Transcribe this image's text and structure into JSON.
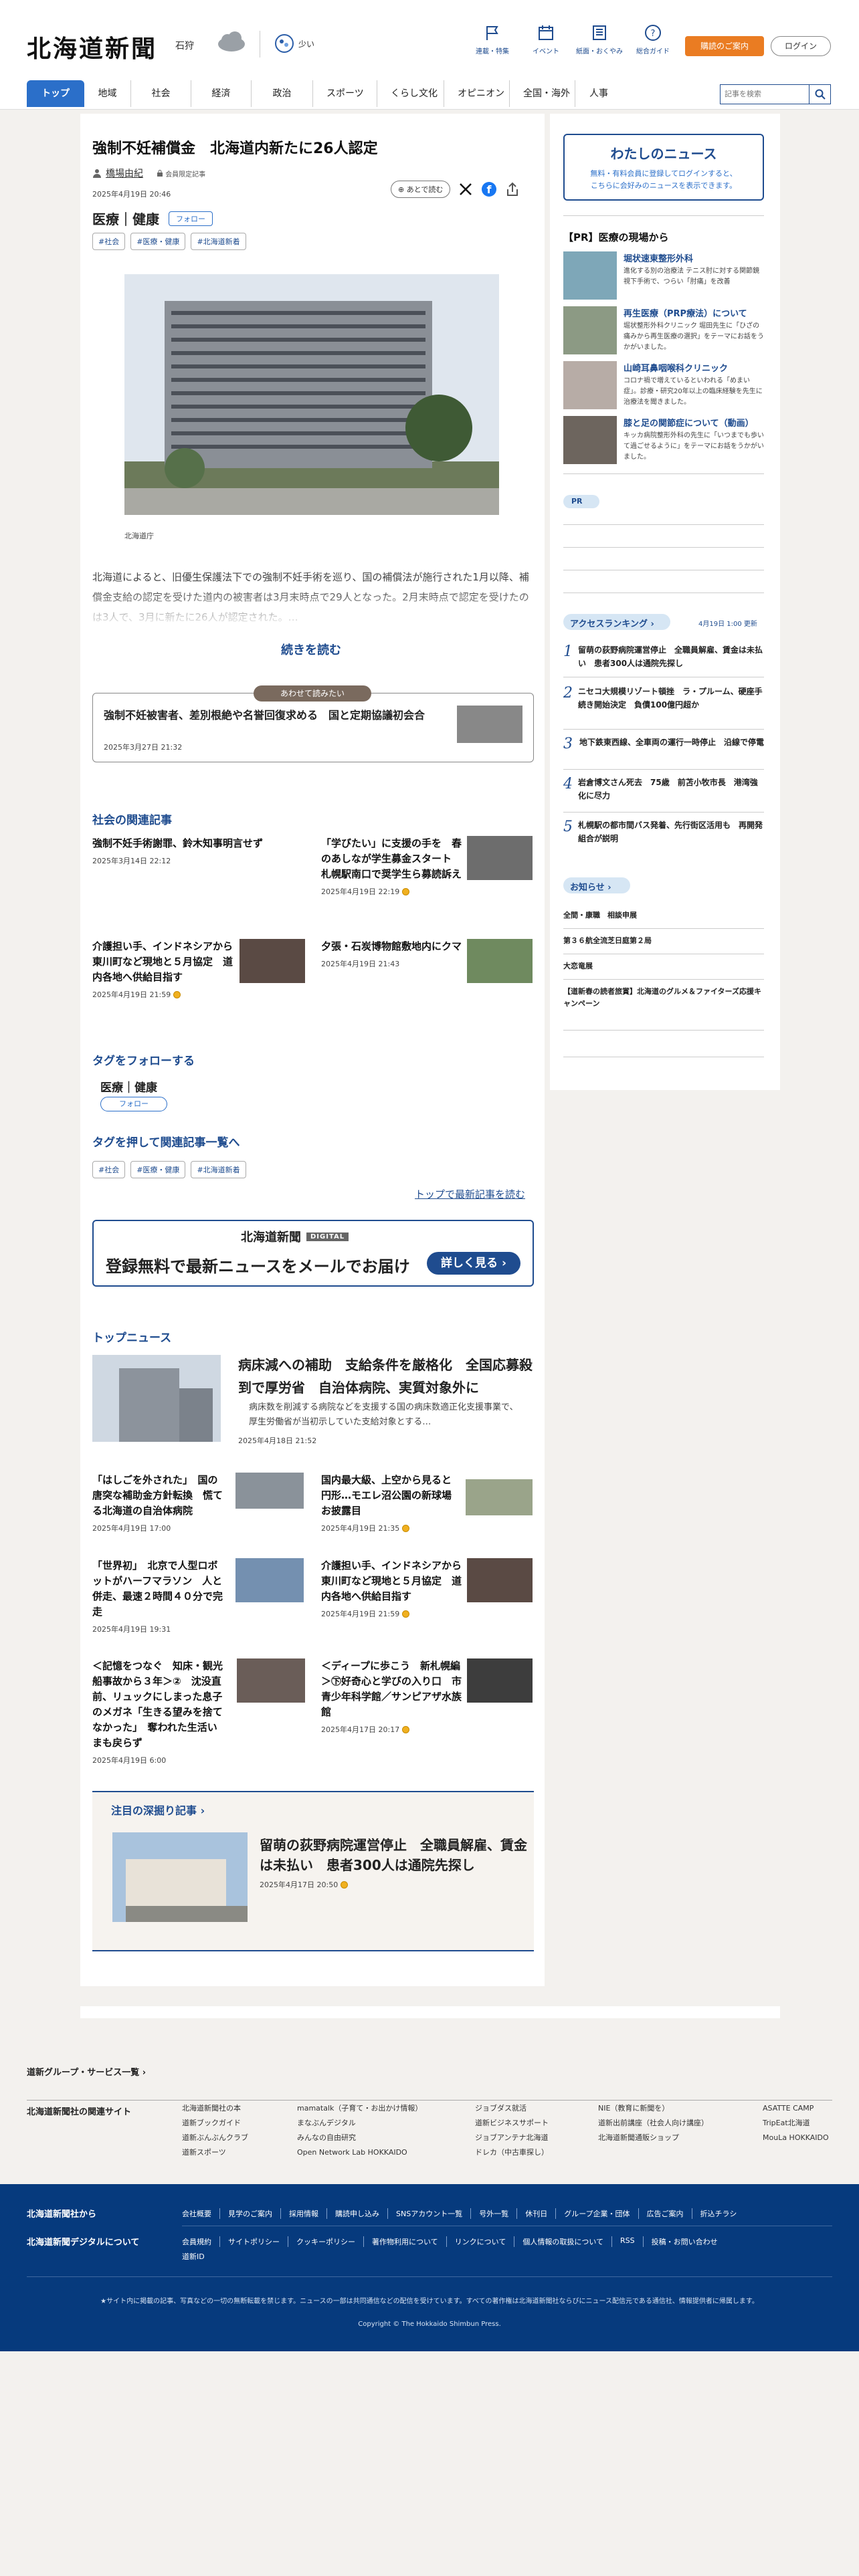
{
  "header": {
    "logo": "北海道新聞",
    "location": "石狩",
    "pollen": "少い",
    "icons": [
      {
        "label": "連載・特集",
        "icon": "flag-icon"
      },
      {
        "label": "イベント",
        "icon": "calendar-icon"
      },
      {
        "label": "紙面・おくやみ",
        "icon": "newspaper-icon"
      },
      {
        "label": "総合ガイド",
        "icon": "question-icon"
      }
    ],
    "subscribe": "購読のご案内",
    "login": "ログイン"
  },
  "nav": {
    "items": [
      "トップ",
      "地域",
      "社会",
      "経済",
      "政治",
      "スポーツ",
      "くらし文化",
      "オピニオン",
      "全国・海外",
      "人事"
    ],
    "search_placeholder": "記事を検索"
  },
  "article": {
    "title": "強制不妊補償金　北海道内新たに26人認定",
    "author": "橋場由紀",
    "member_tag": "会員限定記事",
    "date": "2025年4月19日 20:46",
    "later": "あとで読む",
    "categories": "医療｜健康",
    "follow": "フォロー",
    "tags": [
      "#社会",
      "#医療・健康",
      "#北海道新着"
    ],
    "caption": "北海道庁",
    "lead": "北海道によると、旧優生保護法下での強制不妊手術を巡り、国の補償法が施行された1月以降、補償金支給の認定を受けた道内の被害者は3月末時点で29人となった。2月末時点で認定を受けたのは3人で、3月に新たに26人が認定された。…",
    "read_more": "続きを読む"
  },
  "also_read": {
    "badge": "あわせて読みたい",
    "title": "強制不妊被害者、差別根絶や名誉回復求める　国と定期協議初会合",
    "date": "2025年3月27日 21:32"
  },
  "related": {
    "heading": "社会の関連記事",
    "items": [
      {
        "title": "強制不妊手術謝罪、鈴木知事明言せず",
        "date": "2025年3月14日 22:12"
      },
      {
        "title": "「学びたい」に支援の手を　春のあしなが学生募金スタート　札幌駅南口で奨学生ら募読訴え",
        "date": "2025年4月19日 22:19"
      },
      {
        "title": "介護担い手、インドネシアから　東川町など現地と５月協定　道内各地へ供給目指す",
        "date": "2025年4月19日 21:59"
      },
      {
        "title": "夕張・石炭博物館敷地内にクマ",
        "date": "2025年4月19日 21:43"
      }
    ]
  },
  "follow_tags": {
    "heading": "タグをフォローする",
    "name": "医療｜健康",
    "button": "フォロー"
  },
  "tag_links": {
    "heading": "タグを押して関連記事一覧へ",
    "tags": [
      "#社会",
      "#医療・健康",
      "#北海道新着"
    ],
    "more": "トップで最新記事を読む"
  },
  "banner": {
    "logo": "北海道新聞",
    "digital": "DIGITAL",
    "text": "登録無料で最新ニュースをメールでお届け",
    "button": "詳しく見る"
  },
  "top_news": {
    "heading": "トップニュース",
    "main": {
      "title": "病床減への補助　支給条件を厳格化　全国応募殺到で厚労省　自治体病院、実質対象外に",
      "summary": "病床数を削減する病院などを支援する国の病床数適正化支援事業で、厚生労働省が当初示していた支給対象とする…",
      "date": "2025年4月18日 21:52"
    },
    "items": [
      {
        "title": "「はしごを外された」　国の唐突な補助金方針転換　慌てる北海道の自治体病院",
        "date": "2025年4月19日 17:00"
      },
      {
        "title": "国内最大級、上空から見ると円形…モエレ沼公園の新球場お披露目",
        "date": "2025年4月19日 21:35"
      },
      {
        "title": "「世界初」　北京で人型ロボットがハーフマラソン　人と併走、最速２時間４０分で完走",
        "date": "2025年4月19日 19:31"
      },
      {
        "title": "介護担い手、インドネシアから　東川町など現地と５月協定　道内各地へ供給目指す",
        "date": "2025年4月19日 21:59"
      },
      {
        "title": "＜記憶をつなぐ　知床・観光船事故から３年＞②　沈没直前、リュックにしまった息子のメガネ「生きる望みを捨てなかった」　奪われた生活いまも戻らず",
        "date": "2025年4月19日 6:00"
      },
      {
        "title": "＜ディープに歩こう　新札幌編＞㊦好奇心と学びの入り口　市青少年科学館／サンピアザ水族館",
        "date": "2025年4月17日 20:17"
      }
    ]
  },
  "deep_dive": {
    "heading": "注目の深掘り記事",
    "title": "留萌の荻野病院運営停止　全職員解雇、賃金は未払い　患者300人は通院先探し",
    "date": "2025年4月17日 20:50"
  },
  "sidebar": {
    "mynews_title": "わたしのニュース",
    "mynews_text1": "無料・有料会員に登録してログインすると、",
    "mynews_text2": "こちらに会好みのニュースを表示できます。",
    "pr_heading": "【PR】医療の現場から",
    "pr_items": [
      {
        "title": "堀状速東整形外科",
        "text": "進化する別の治療法 テニス肘に対する関節鏡視下手術で、つらい「肘痛」を改善"
      },
      {
        "title": "再生医療（PRP療法）について",
        "text": "堀状整形外科クリニック 堀田先生に「ひざの痛みから再生医療の選択」をテーマにお話をうかがいました。"
      },
      {
        "title": "山崎耳鼻咽喉科クリニック",
        "text": "コロナ禍で増えているといわれる「めまい症」。診療・研究20年以上の臨床経験を先生に治療法を聞きました。"
      },
      {
        "title": "膝と足の関節症について（動画）",
        "text": "キッカ病院整形外科の先生に「いつまでも歩いて過ごせるように」をテーマにお話をうかがいました。"
      }
    ],
    "pr_label": "PR",
    "ranking_heading": "アクセスランキング",
    "ranking_time": "4月19日 1:00 更新",
    "ranking": [
      {
        "rank": "1",
        "title": "留萌の荻野病院運営停止　全職員解雇、賃金は未払い　患者300人は通院先探し"
      },
      {
        "rank": "2",
        "title": "ニセコ大規模リゾート頓挫　ラ・プルーム、硬座手続き開始決定　負債100億円超か"
      },
      {
        "rank": "3",
        "title": "地下鉄東西線、全車両の運行一時停止　沿線で停電"
      },
      {
        "rank": "4",
        "title": "岩倉博文さん死去　75歳　前苫小牧市長　港湾強化に尽力"
      },
      {
        "rank": "5",
        "title": "札幌駅の都市間バス発着、先行街区活用も　再開発組合が説明"
      }
    ],
    "notice_heading": "お知らせ",
    "notices": [
      "全間・康職　相談申展",
      "第３６航全流芝日庭第２局",
      "大恋竜展",
      "【道新春の読者旅賞】北海道のグルメ＆ファイターズ応援キャンペーン"
    ]
  },
  "footer": {
    "group_heading": "道新グループ・サービス一覧",
    "related_heading": "北海道新聞社の関連サイト",
    "cols": [
      [
        "北海道新聞社の本",
        "道新ブックガイド",
        "道新ぶんぶんクラブ",
        "道新スポーツ"
      ],
      [
        "mamatalk（子育て・お出かけ情報）",
        "まなぶんデジタル",
        "みんなの自由研究",
        "Open Network Lab HOKKAIDO"
      ],
      [
        "ジョブダス就活",
        "道新ビジネスサポート",
        "ジョブアンテナ北海道",
        "ドレカ（中古車探し）"
      ],
      [
        "NIE（教育に新聞を）",
        "道新出前講座（社会人向け講座）",
        "北海道新聞通販ショップ"
      ],
      [
        "ASATTE CAMP",
        "TripEat北海道",
        "MouLa HOKKAIDO"
      ]
    ],
    "dark_heading1": "北海道新聞社から",
    "dark_heading2": "北海道新聞デジタルについて",
    "row1": [
      "会社概要",
      "見学のご案内",
      "採用情報",
      "購読申し込み",
      "SNSアカウント一覧",
      "号外一覧",
      "休刊日",
      "グループ企業・団体",
      "広告ご案内",
      "折込チラシ"
    ],
    "row2": [
      "会員規約",
      "サイトポリシー",
      "クッキーポリシー",
      "著作物利用について",
      "リンクについて",
      "個人情報の取扱について",
      "RSS",
      "投稿・お問い合わせ"
    ],
    "row3": [
      "道新ID"
    ],
    "note": "★サイト内に掲載の記事、写真などの一切の無断転載を禁じます。ニュースの一部は共同通信などの配信を受けています。すべての著作権は北海道新聞社ならびにニュース配信元である通信社、情報提供者に帰属します。",
    "copyright": "Copyright © The Hokkaido Shimbun Press."
  }
}
